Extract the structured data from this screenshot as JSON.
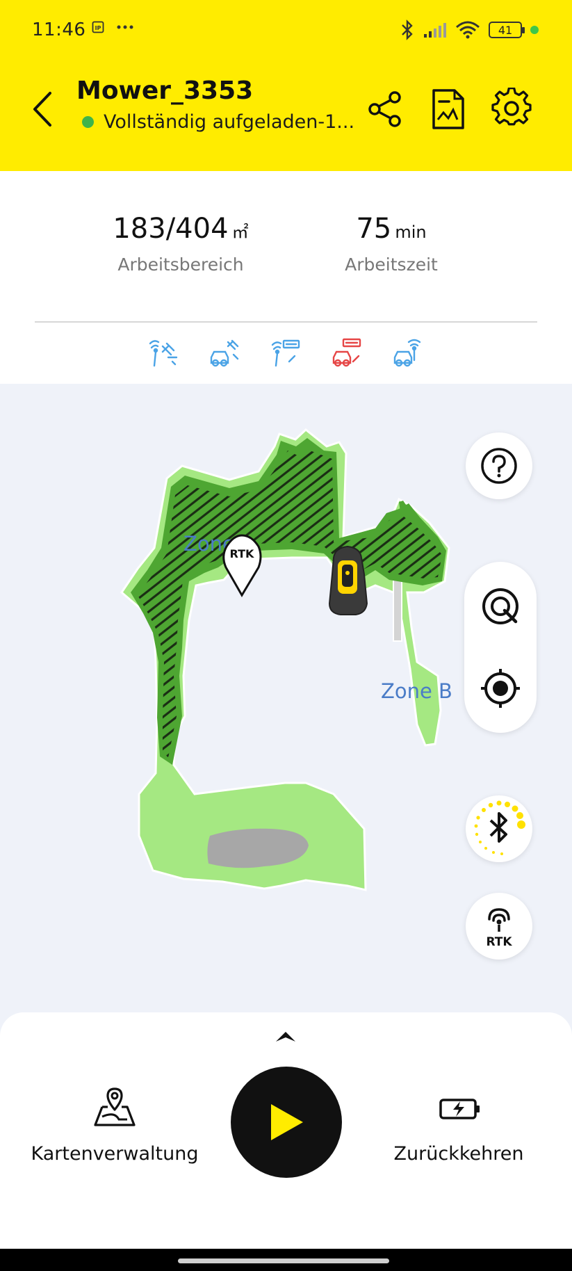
{
  "status_bar": {
    "time": "11:46",
    "battery": "41",
    "icons": [
      "ip-icon",
      "more-dots-icon",
      "bluetooth-icon",
      "signal-icon",
      "wifi-icon",
      "battery-icon",
      "active-dot"
    ]
  },
  "header": {
    "title": "Mower_3353",
    "status": "Vollständig aufgeladen-1...",
    "status_color": "#3fb44a",
    "bg_color": "#ffec00",
    "icons": [
      "back-icon",
      "share-icon",
      "report-icon",
      "gear-icon"
    ]
  },
  "stats": {
    "area_value": "183/404",
    "area_unit": "㎡",
    "area_label": "Arbeitsbereich",
    "time_value": "75",
    "time_unit": "min",
    "time_label": "Arbeitszeit"
  },
  "device_status_icons": [
    {
      "name": "gps-satellite-icon",
      "color": "#4aa3e6"
    },
    {
      "name": "mower-satellite-icon",
      "color": "#4aa3e6"
    },
    {
      "name": "station-signal-icon",
      "color": "#4aa3e6"
    },
    {
      "name": "mower-station-alert-icon",
      "color": "#e64545"
    },
    {
      "name": "mower-wifi-icon",
      "color": "#4aa3e6"
    }
  ],
  "map": {
    "zone_a_label": "Zone A",
    "zone_b_label": "Zone B",
    "rtk_marker": "RTK",
    "rtk_button_label": "RTK",
    "colors": {
      "lawn": "#a5e882",
      "mowed": "#4ea632",
      "mower_accent": "#ffd400",
      "zone_label": "#4a7cc7"
    }
  },
  "bottom": {
    "map_management": "Kartenverwaltung",
    "return": "Zurückkehren"
  }
}
